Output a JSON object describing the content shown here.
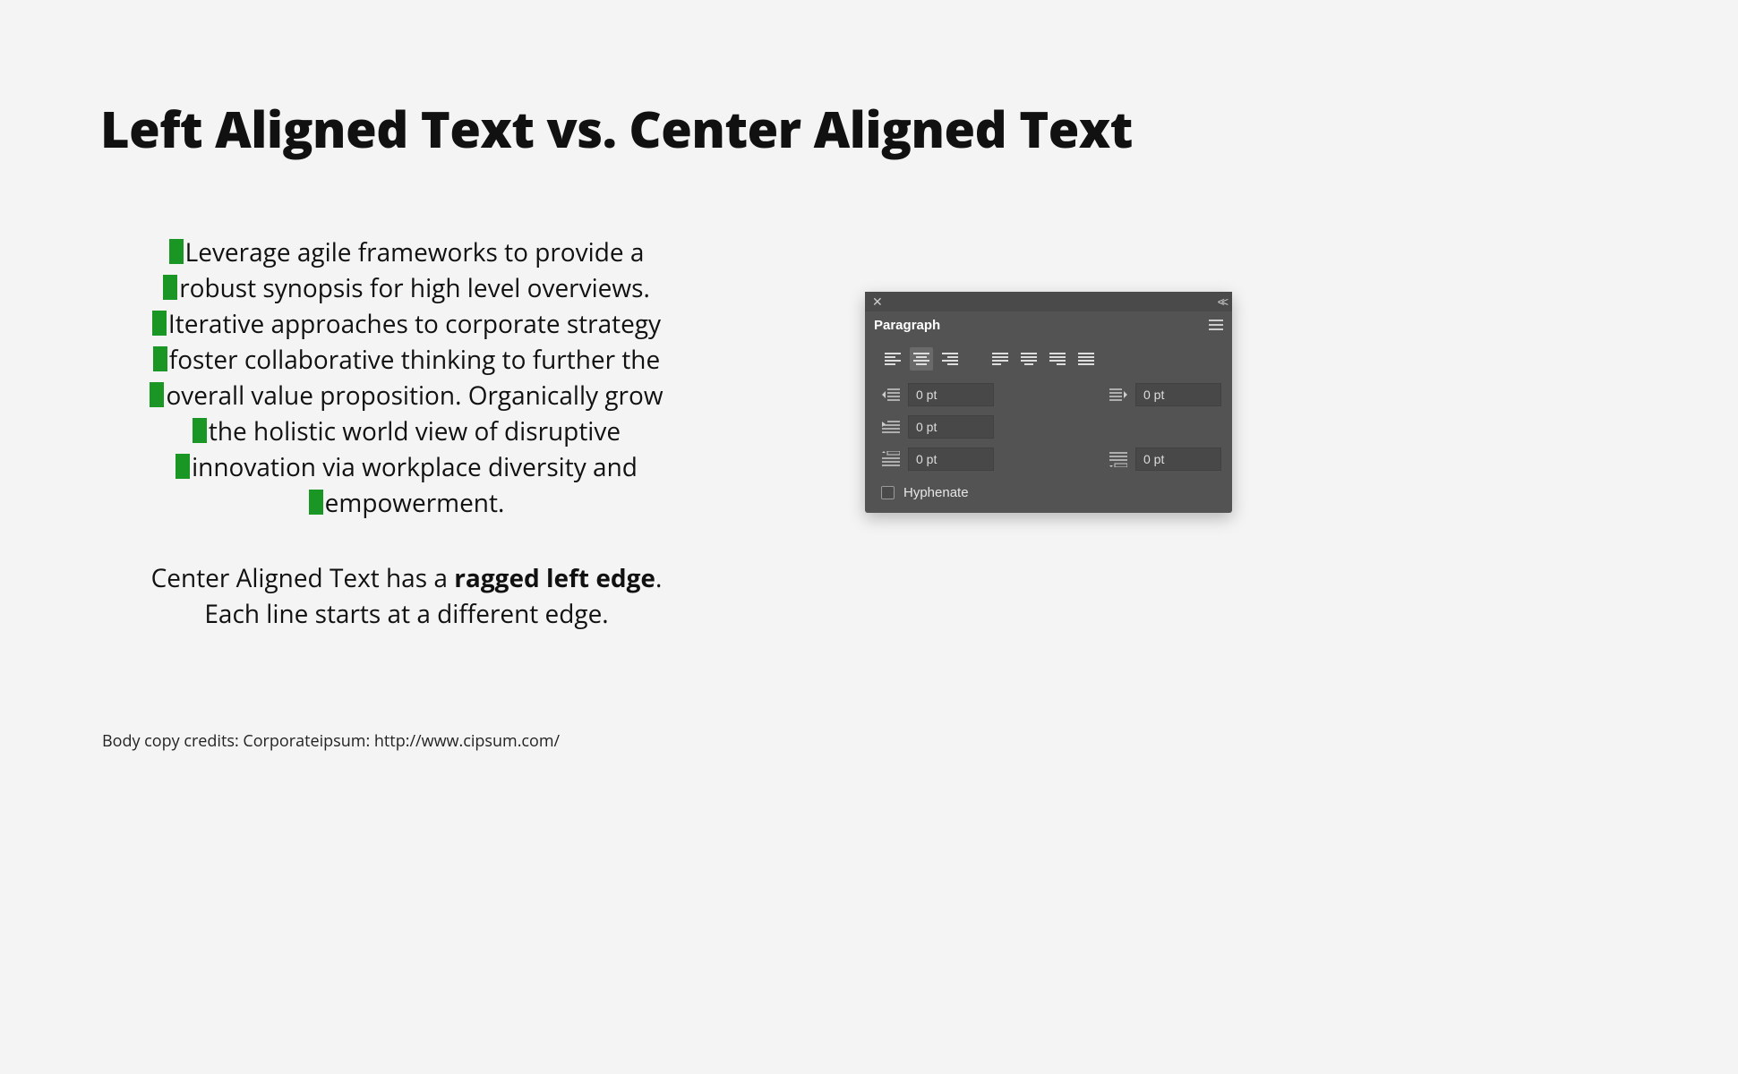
{
  "title": "Left Aligned Text vs. Center Aligned Text",
  "sample": {
    "lines": [
      "Leverage agile frameworks to provide a",
      "robust synopsis for high level overviews.",
      "Iterative approaches to corporate strategy",
      "foster collaborative thinking to further the",
      "overall value proposition. Organically grow",
      "the holistic world view of disruptive",
      "innovation via workplace diversity and",
      "empowerment."
    ]
  },
  "caption": {
    "prefix": "Center Aligned Text has a ",
    "bold": "ragged left edge",
    "suffix1": ".",
    "line2": "Each line starts at a different edge."
  },
  "credits": "Body copy credits: Corporateipsum: http://www.cipsum.com/",
  "panel": {
    "tab": "Paragraph",
    "align": {
      "selected_index": 1,
      "buttons": [
        "align-left",
        "align-center",
        "align-right",
        "justify-left",
        "justify-center",
        "justify-right",
        "justify-all"
      ]
    },
    "fields": {
      "indent_left": "0 pt",
      "indent_right": "0 pt",
      "first_line_indent": "0 pt",
      "space_before": "0 pt",
      "space_after": "0 pt"
    },
    "hyphenate_label": "Hyphenate",
    "hyphenate_checked": false
  }
}
